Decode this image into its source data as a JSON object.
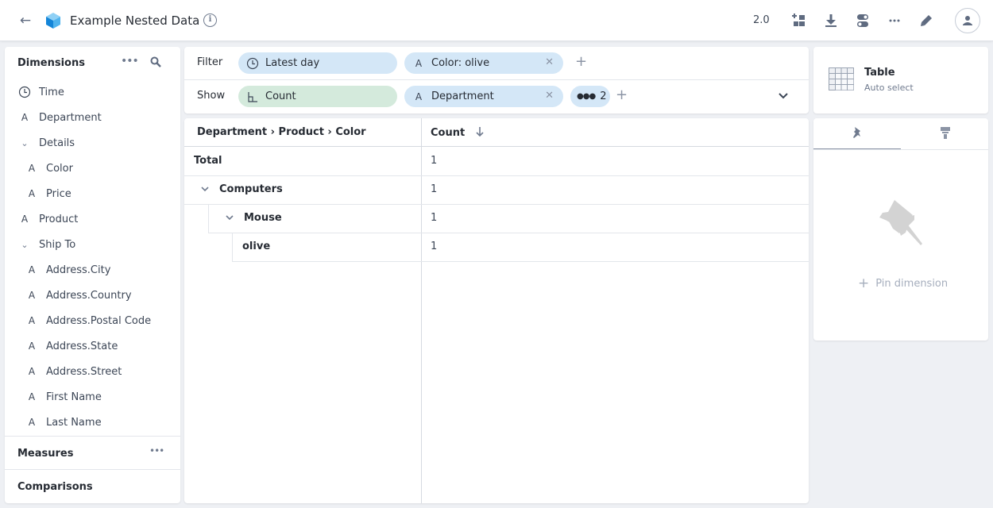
{
  "header": {
    "back_icon": "arrow-left-icon",
    "logo_icon": "cube-icon",
    "title": "Example Nested Data",
    "info_icon": "info-icon",
    "version": "2.0",
    "actions": [
      "add-dashboard-icon",
      "download-icon",
      "toggle-settings-icon",
      "more-icon",
      "edit-icon"
    ],
    "avatar_icon": "user-icon"
  },
  "sidebar": {
    "dimensions_title": "Dimensions",
    "more_icon": "more-icon",
    "search_icon": "search-icon",
    "items": [
      {
        "label": "Time",
        "icon": "clock-icon",
        "level": 0
      },
      {
        "label": "Department",
        "icon": "text-type-icon",
        "level": 0
      },
      {
        "label": "Details",
        "icon": "chevron-down-icon",
        "level": 0
      },
      {
        "label": "Color",
        "icon": "text-type-icon",
        "level": 1
      },
      {
        "label": "Price",
        "icon": "text-type-icon",
        "level": 1
      },
      {
        "label": "Product",
        "icon": "text-type-icon",
        "level": 0
      },
      {
        "label": "Ship To",
        "icon": "chevron-down-icon",
        "level": 0
      },
      {
        "label": "Address.City",
        "icon": "text-type-icon",
        "level": 1
      },
      {
        "label": "Address.Country",
        "icon": "text-type-icon",
        "level": 1
      },
      {
        "label": "Address.Postal Code",
        "icon": "text-type-icon",
        "level": 1
      },
      {
        "label": "Address.State",
        "icon": "text-type-icon",
        "level": 1
      },
      {
        "label": "Address.Street",
        "icon": "text-type-icon",
        "level": 1
      },
      {
        "label": "First Name",
        "icon": "text-type-icon",
        "level": 1
      },
      {
        "label": "Last Name",
        "icon": "text-type-icon",
        "level": 1
      }
    ],
    "measures_title": "Measures",
    "comparisons_title": "Comparisons"
  },
  "query": {
    "filter_label": "Filter",
    "show_label": "Show",
    "filters": [
      {
        "label": "Latest day",
        "icon": "clock-icon",
        "removable": false
      },
      {
        "label": "Color: olive",
        "icon": "text-type-icon",
        "removable": true
      }
    ],
    "shows": [
      {
        "label": "Count",
        "icon": "measure-icon",
        "removable": false
      },
      {
        "label": "Department",
        "icon": "text-type-icon",
        "removable": true
      }
    ],
    "overflow_count": "2",
    "colors": {
      "dimension_pill": "#d4e7f7",
      "measure_pill": "#d4eadc"
    }
  },
  "table": {
    "headers": [
      "Department › Product › Color",
      "Count"
    ],
    "sort_icon": "arrow-down-icon",
    "rows": [
      {
        "label": "Total",
        "value": "1",
        "level": 0,
        "expandable": false
      },
      {
        "label": "Computers",
        "value": "1",
        "level": 0,
        "expandable": true
      },
      {
        "label": "Mouse",
        "value": "1",
        "level": 1,
        "expandable": true
      },
      {
        "label": "olive",
        "value": "1",
        "level": 2,
        "expandable": false
      }
    ]
  },
  "viz": {
    "title": "Table",
    "subtitle": "Auto select",
    "icon": "table-grid-icon"
  },
  "pins": {
    "tabs": [
      "pin-icon",
      "paint-brush-icon"
    ],
    "empty_icon": "pushpin-icon",
    "add_label": "Pin dimension"
  }
}
